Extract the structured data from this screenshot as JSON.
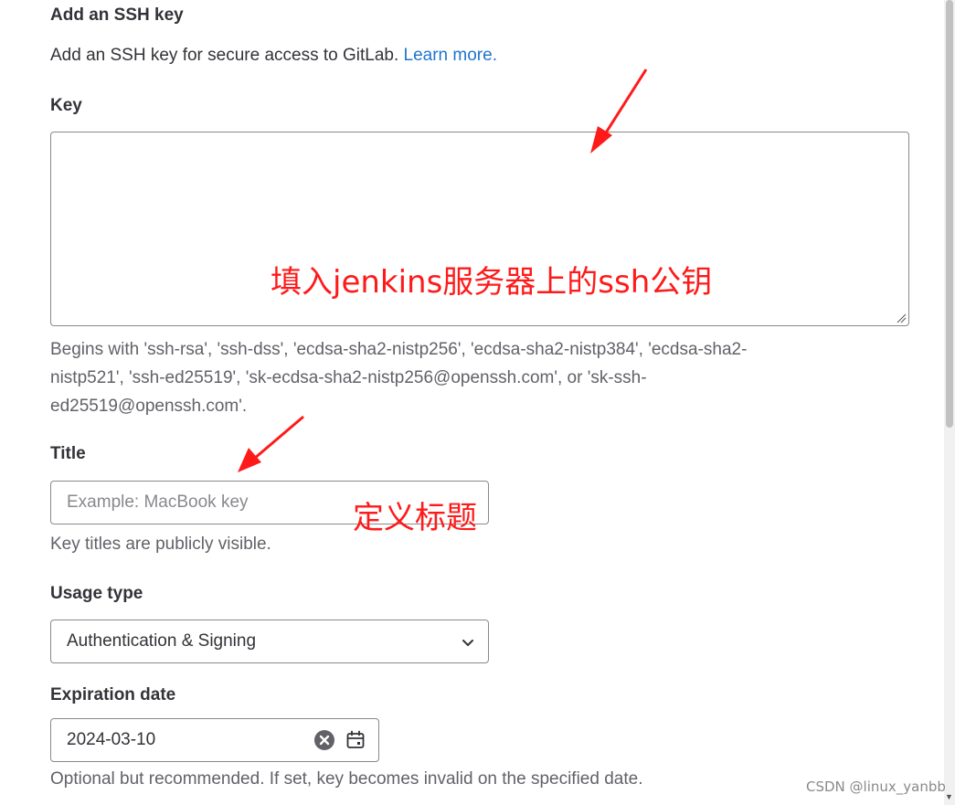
{
  "form": {
    "section_title": "Add an SSH key",
    "section_desc": "Add an SSH key for secure access to GitLab.",
    "learn_more": "Learn more.",
    "key": {
      "label": "Key",
      "value": "",
      "help_line1": "Begins with 'ssh-rsa', 'ssh-dss', 'ecdsa-sha2-nistp256', 'ecdsa-sha2-nistp384', 'ecdsa-sha2-",
      "help_line2": "nistp521', 'ssh-ed25519', 'sk-ecdsa-sha2-nistp256@openssh.com', or 'sk-ssh-",
      "help_line3": "ed25519@openssh.com'."
    },
    "title": {
      "label": "Title",
      "placeholder": "Example: MacBook key",
      "help": "Key titles are publicly visible."
    },
    "usage_type": {
      "label": "Usage type",
      "selected": "Authentication & Signing"
    },
    "expiration": {
      "label": "Expiration date",
      "value": "2024-03-10",
      "help": "Optional but recommended. If set, key becomes invalid on the specified date."
    }
  },
  "annotations": {
    "key_note": "填入jenkins服务器上的ssh公钥",
    "title_note": "定义标题",
    "color": "#ff1a1a"
  },
  "watermark": "CSDN @linux_yanbb",
  "colors": {
    "link": "#1f75cb",
    "text": "#333238",
    "muted": "#626168",
    "border": "#89888d"
  },
  "icons": {
    "select": "chevron-down-icon",
    "clear": "clear-circle-icon",
    "calendar": "calendar-icon"
  }
}
